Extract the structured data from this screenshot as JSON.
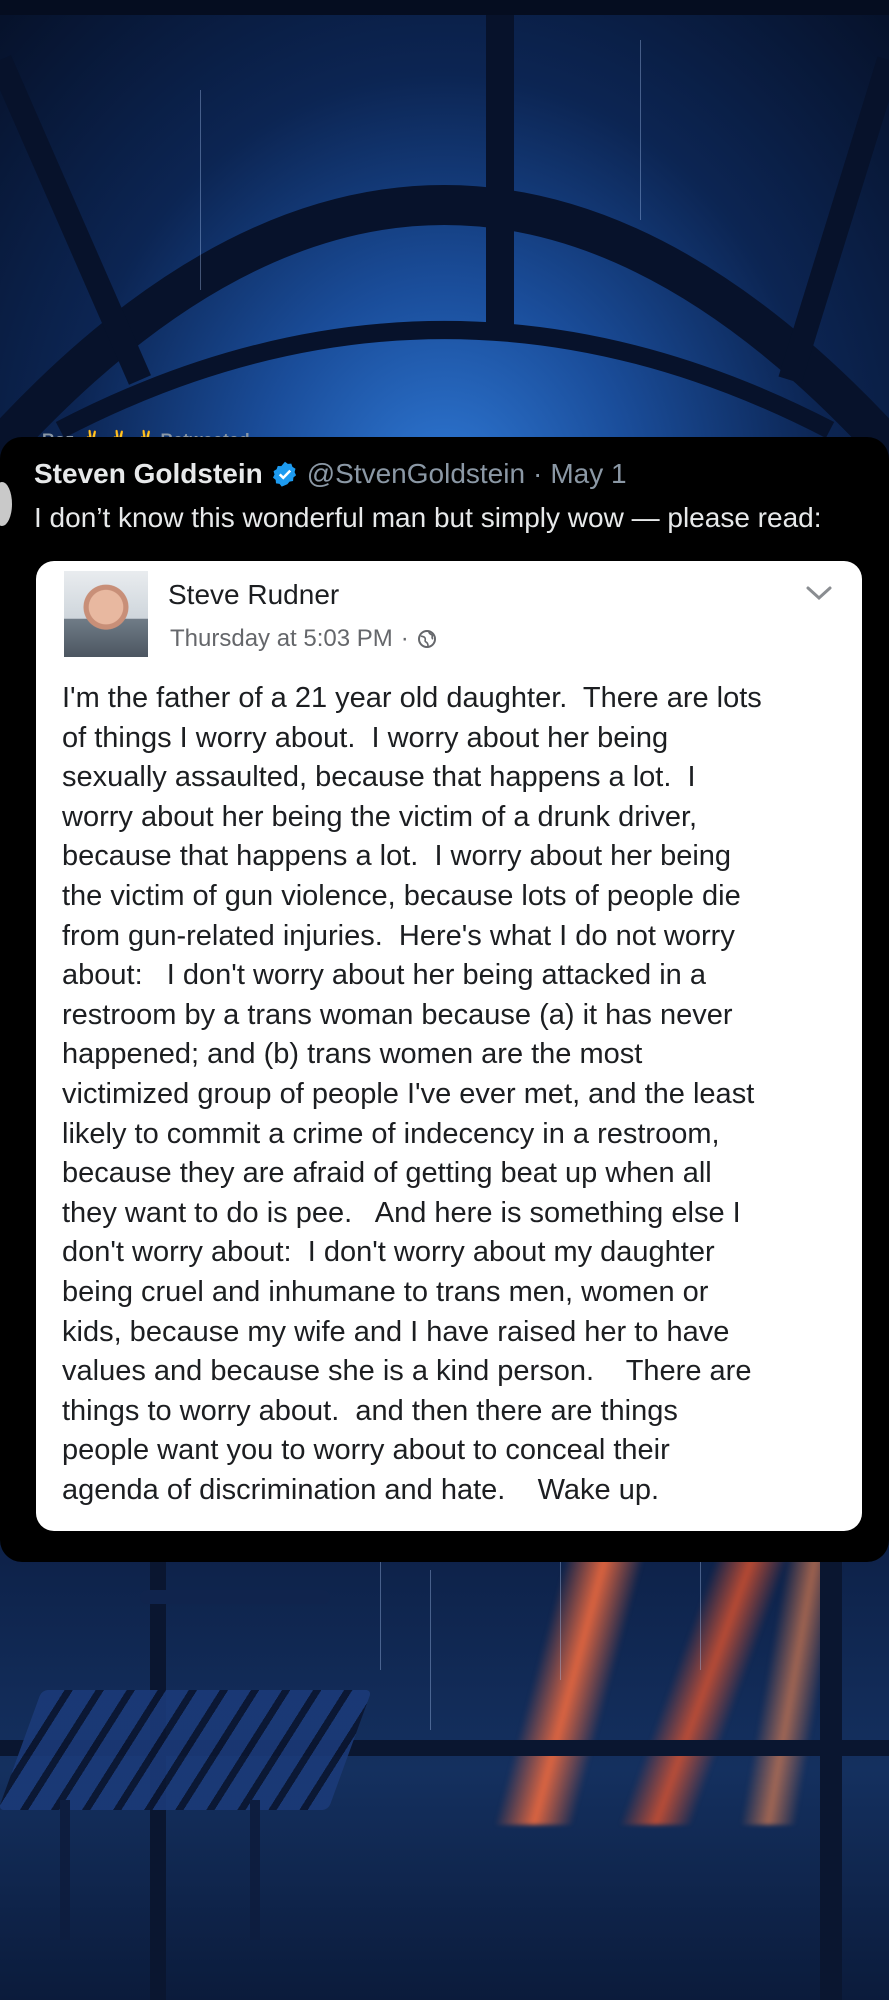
{
  "tweet": {
    "retweet_label": "Roz ✌ ✌ ✌ Retweeted",
    "author_name": "Steven Goldstein",
    "handle": "@StvenGoldstein",
    "separator": "·",
    "date": "May 1",
    "text": "I don’t know this wonderful man but simply wow — please read:",
    "verified_icon": "verified-badge-icon",
    "verified_color": "#1d9bf0"
  },
  "embedded_post": {
    "author_name": "Steve Rudner",
    "timestamp": "Thursday at 5:03 PM",
    "meta_separator": "·",
    "privacy_icon": "globe-icon",
    "menu_icon": "chevron-down-icon",
    "body_lines": [
      "I'm the father of a 21 year old daughter.  There are lots",
      "of things I worry about.  I worry about her being",
      "sexually assaulted, because that happens a lot.  I",
      "worry about her being the victim of a drunk driver,",
      "because that happens a lot.  I worry about her being",
      "the victim of gun violence, because lots of people die",
      "from gun-related injuries.  Here's what I do not worry",
      "about:   I don't worry about her being attacked in a",
      "restroom by a trans woman because (a) it has never",
      "happened; and (b) trans women are the most",
      "victimized group of people I've ever met, and the least",
      "likely to commit a crime of indecency in a restroom,",
      "because they are afraid of getting beat up when all",
      "they want to do is pee.   And here is something else I",
      "don't worry about:  I don't worry about my daughter",
      "being cruel and inhumane to trans men, women or",
      "kids, because my wife and I have raised her to have",
      "values and because she is a kind person.    There are",
      "things to worry about.  and then there are things",
      "people want you to worry about to conceal their",
      "agenda of discrimination and hate.    Wake up."
    ]
  }
}
